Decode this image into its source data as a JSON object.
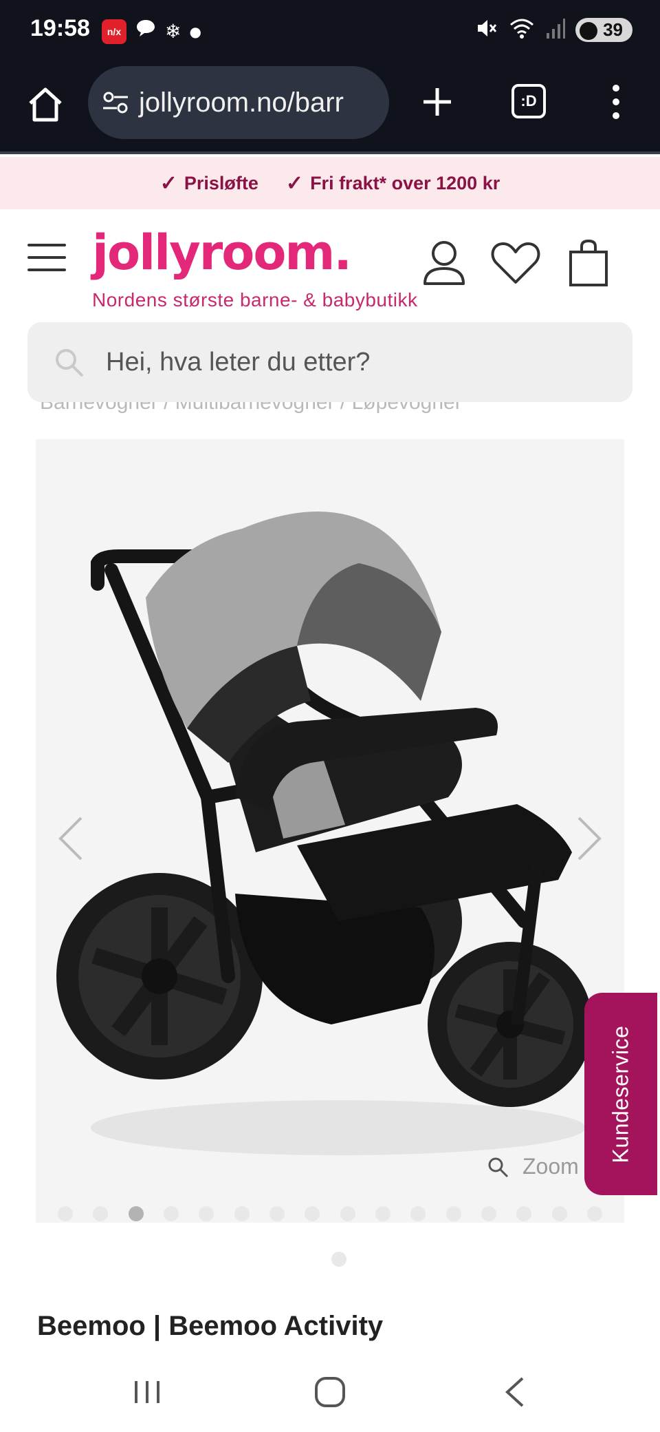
{
  "status_bar": {
    "time": "19:58",
    "left_icons": [
      "nx-app-icon",
      "chat-bubble-icon",
      "snowflake-icon",
      "dot-icon"
    ],
    "nx_label": "n/x",
    "battery": "39",
    "right_icons": [
      "mute-icon",
      "wifi-icon",
      "signal-icon",
      "battery-icon"
    ]
  },
  "browser": {
    "url": "jollyroom.no/barr",
    "tabs_label": ":D",
    "icons": [
      "home-icon",
      "site-settings-icon",
      "plus-icon",
      "tabs-icon",
      "more-vert-icon"
    ]
  },
  "promo": {
    "items": [
      "Prisløfte",
      "Fri frakt* over 1200 kr"
    ]
  },
  "header": {
    "logo": "jollyroom.",
    "tagline": "Nordens største barne- & babybutikk",
    "icons": [
      "menu-icon",
      "user-icon",
      "heart-icon",
      "shopping-bag-icon"
    ]
  },
  "search": {
    "placeholder": "Hei, hva leter du etter?"
  },
  "breadcrumb": {
    "text": "Barnevogner / Multibarnevogner / Løpevogner"
  },
  "gallery": {
    "zoom_label": "Zoom",
    "dot_count": 16,
    "active_dot": 3
  },
  "support_tab": {
    "label": "Kundeservice"
  },
  "product": {
    "title": "Beemoo | Beemoo Activity"
  },
  "colors": {
    "brand_pink": "#e3287a",
    "promo_text": "#8b1245",
    "support_tab": "#a3145c",
    "status_bg": "#10131b"
  }
}
